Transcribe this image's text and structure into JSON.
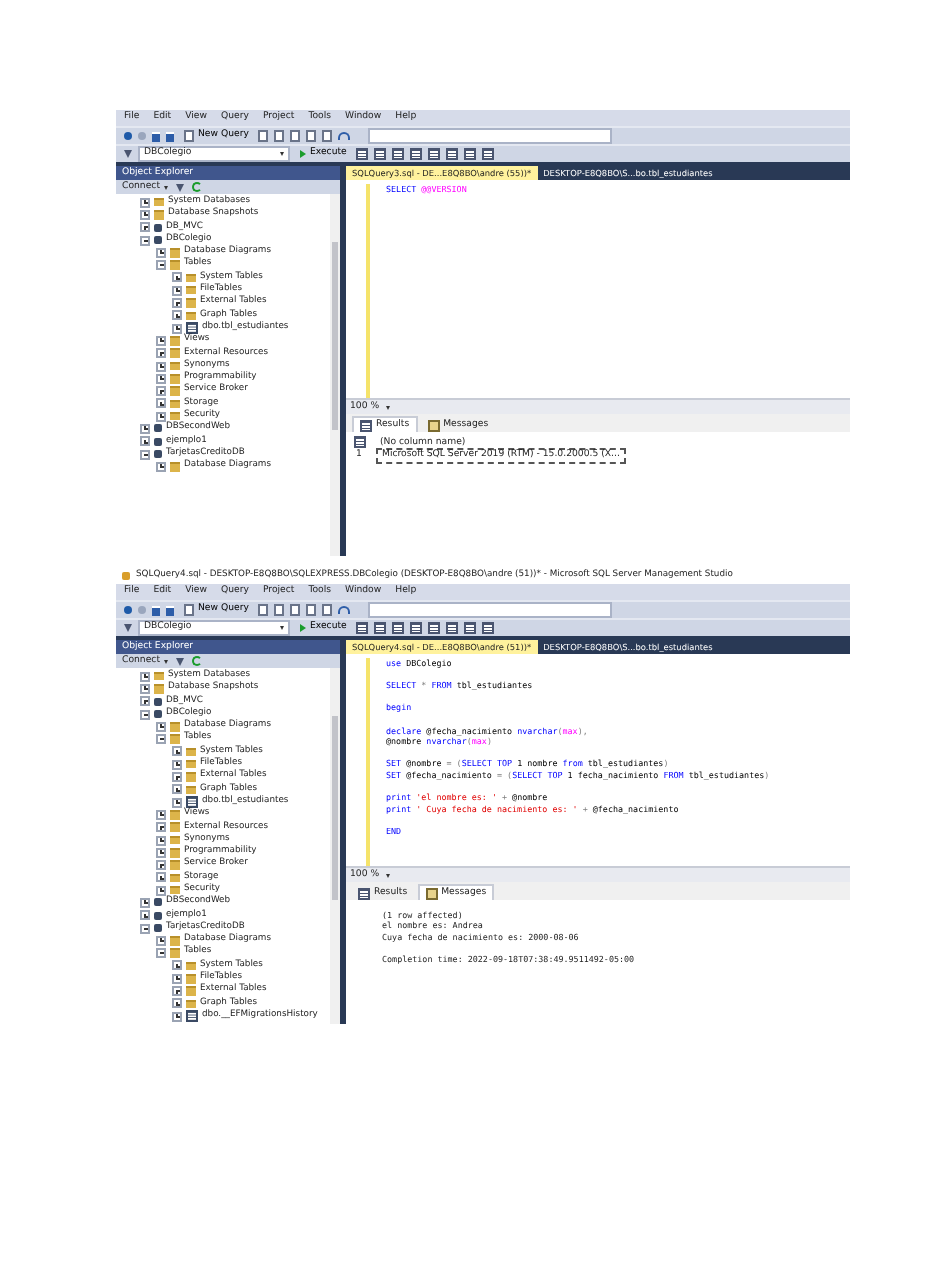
{
  "shots": [
    {
      "menu": [
        "File",
        "Edit",
        "View",
        "Query",
        "Project",
        "Tools",
        "Window",
        "Help"
      ],
      "toolbar": {
        "new_query": "New Query",
        "database": "DBColegio",
        "execute": "Execute"
      },
      "explorer": {
        "title": "Object Explorer",
        "connect": "Connect",
        "tree": [
          {
            "label": "System Databases",
            "kind": "folder",
            "expanded": false
          },
          {
            "label": "Database Snapshots",
            "kind": "folder",
            "expanded": false
          },
          {
            "label": "DB_MVC",
            "kind": "db",
            "expanded": false
          },
          {
            "label": "DBColegio",
            "kind": "db",
            "expanded": true,
            "children": [
              {
                "label": "Database Diagrams",
                "kind": "folder",
                "expanded": false
              },
              {
                "label": "Tables",
                "kind": "folder",
                "expanded": true,
                "children": [
                  {
                    "label": "System Tables",
                    "kind": "folder",
                    "expanded": false
                  },
                  {
                    "label": "FileTables",
                    "kind": "folder",
                    "expanded": false
                  },
                  {
                    "label": "External Tables",
                    "kind": "folder",
                    "expanded": false
                  },
                  {
                    "label": "Graph Tables",
                    "kind": "folder",
                    "expanded": false
                  },
                  {
                    "label": "dbo.tbl_estudiantes",
                    "kind": "table",
                    "expanded": false
                  }
                ]
              },
              {
                "label": "Views",
                "kind": "folder",
                "expanded": false
              },
              {
                "label": "External Resources",
                "kind": "folder",
                "expanded": false
              },
              {
                "label": "Synonyms",
                "kind": "folder",
                "expanded": false
              },
              {
                "label": "Programmability",
                "kind": "folder",
                "expanded": false
              },
              {
                "label": "Service Broker",
                "kind": "folder",
                "expanded": false
              },
              {
                "label": "Storage",
                "kind": "folder",
                "expanded": false
              },
              {
                "label": "Security",
                "kind": "folder",
                "expanded": false
              }
            ]
          },
          {
            "label": "DBSecondWeb",
            "kind": "db",
            "expanded": false
          },
          {
            "label": "ejemplo1",
            "kind": "db",
            "expanded": false
          },
          {
            "label": "TarjetasCreditoDB",
            "kind": "db",
            "expanded": true,
            "children": [
              {
                "label": "Database Diagrams",
                "kind": "folder",
                "expanded": false
              }
            ]
          }
        ]
      },
      "tabs": [
        {
          "label": "SQLQuery3.sql - DE...E8Q8BO\\andre (55))*",
          "selected": true
        },
        {
          "label": "DESKTOP-E8Q8BO\\S...bo.tbl_estudiantes",
          "selected": false
        }
      ],
      "code": [
        {
          "segments": [
            {
              "text": "SELECT ",
              "kind": "keyword"
            },
            {
              "text": "@@VERSION",
              "kind": "function"
            }
          ]
        }
      ],
      "zoom": "100 %",
      "result_tabs": [
        {
          "label": "Results",
          "selected": true
        },
        {
          "label": "Messages",
          "selected": false
        }
      ],
      "results": {
        "kind": "grid",
        "columns": [
          "",
          "(No column name)"
        ],
        "rows": [
          [
            "1",
            "Microsoft SQL Server 2019 (RTM) - 15.0.2000.5 (X..."
          ]
        ]
      }
    },
    {
      "title": "SQLQuery4.sql - DESKTOP-E8Q8BO\\SQLEXPRESS.DBColegio (DESKTOP-E8Q8BO\\andre (51))* - Microsoft SQL Server Management Studio",
      "menu": [
        "File",
        "Edit",
        "View",
        "Query",
        "Project",
        "Tools",
        "Window",
        "Help"
      ],
      "toolbar": {
        "new_query": "New Query",
        "database": "DBColegio",
        "execute": "Execute"
      },
      "explorer": {
        "title": "Object Explorer",
        "connect": "Connect",
        "tree": [
          {
            "label": "System Databases",
            "kind": "folder",
            "expanded": false
          },
          {
            "label": "Database Snapshots",
            "kind": "folder",
            "expanded": false
          },
          {
            "label": "DB_MVC",
            "kind": "db",
            "expanded": false
          },
          {
            "label": "DBColegio",
            "kind": "db",
            "expanded": true,
            "children": [
              {
                "label": "Database Diagrams",
                "kind": "folder",
                "expanded": false
              },
              {
                "label": "Tables",
                "kind": "folder",
                "expanded": true,
                "children": [
                  {
                    "label": "System Tables",
                    "kind": "folder",
                    "expanded": false
                  },
                  {
                    "label": "FileTables",
                    "kind": "folder",
                    "expanded": false
                  },
                  {
                    "label": "External Tables",
                    "kind": "folder",
                    "expanded": false
                  },
                  {
                    "label": "Graph Tables",
                    "kind": "folder",
                    "expanded": false
                  },
                  {
                    "label": "dbo.tbl_estudiantes",
                    "kind": "table",
                    "expanded": false
                  }
                ]
              },
              {
                "label": "Views",
                "kind": "folder",
                "expanded": false
              },
              {
                "label": "External Resources",
                "kind": "folder",
                "expanded": false
              },
              {
                "label": "Synonyms",
                "kind": "folder",
                "expanded": false
              },
              {
                "label": "Programmability",
                "kind": "folder",
                "expanded": false
              },
              {
                "label": "Service Broker",
                "kind": "folder",
                "expanded": false
              },
              {
                "label": "Storage",
                "kind": "folder",
                "expanded": false
              },
              {
                "label": "Security",
                "kind": "folder",
                "expanded": false
              }
            ]
          },
          {
            "label": "DBSecondWeb",
            "kind": "db",
            "expanded": false
          },
          {
            "label": "ejemplo1",
            "kind": "db",
            "expanded": false
          },
          {
            "label": "TarjetasCreditoDB",
            "kind": "db",
            "expanded": true,
            "children": [
              {
                "label": "Database Diagrams",
                "kind": "folder",
                "expanded": false
              },
              {
                "label": "Tables",
                "kind": "folder",
                "expanded": true,
                "children": [
                  {
                    "label": "System Tables",
                    "kind": "folder",
                    "expanded": false
                  },
                  {
                    "label": "FileTables",
                    "kind": "folder",
                    "expanded": false
                  },
                  {
                    "label": "External Tables",
                    "kind": "folder",
                    "expanded": false
                  },
                  {
                    "label": "Graph Tables",
                    "kind": "folder",
                    "expanded": false
                  },
                  {
                    "label": "dbo.__EFMigrationsHistory",
                    "kind": "table",
                    "expanded": false
                  }
                ]
              }
            ]
          }
        ]
      },
      "tabs": [
        {
          "label": "SQLQuery4.sql - DE...E8Q8BO\\andre (51))*",
          "selected": true
        },
        {
          "label": "DESKTOP-E8Q8BO\\S...bo.tbl_estudiantes",
          "selected": false
        }
      ],
      "code": [
        {
          "segments": [
            {
              "text": "use ",
              "kind": "keyword"
            },
            {
              "text": "DBColegio",
              "kind": "plain"
            }
          ]
        },
        {
          "gap_before": true,
          "segments": [
            {
              "text": "SELECT ",
              "kind": "keyword"
            },
            {
              "text": "* ",
              "kind": "operator"
            },
            {
              "text": "FROM ",
              "kind": "keyword"
            },
            {
              "text": "tbl_estudiantes",
              "kind": "plain"
            }
          ]
        },
        {
          "gap_before": true,
          "segments": [
            {
              "text": "begin",
              "kind": "keyword"
            }
          ]
        },
        {
          "gap_before": true,
          "segments": [
            {
              "text": "declare ",
              "kind": "keyword"
            },
            {
              "text": "@fecha_nacimiento ",
              "kind": "plain"
            },
            {
              "text": "nvarchar",
              "kind": "keyword"
            },
            {
              "text": "(",
              "kind": "operator"
            },
            {
              "text": "max",
              "kind": "function"
            },
            {
              "text": "),",
              "kind": "operator"
            }
          ]
        },
        {
          "segments": [
            {
              "text": "@nombre ",
              "kind": "plain"
            },
            {
              "text": "nvarchar",
              "kind": "keyword"
            },
            {
              "text": "(",
              "kind": "operator"
            },
            {
              "text": "max",
              "kind": "function"
            },
            {
              "text": ")",
              "kind": "operator"
            }
          ]
        },
        {
          "gap_before": true,
          "segments": [
            {
              "text": "SET ",
              "kind": "keyword"
            },
            {
              "text": "@nombre ",
              "kind": "plain"
            },
            {
              "text": "= (",
              "kind": "operator"
            },
            {
              "text": "SELECT TOP ",
              "kind": "keyword"
            },
            {
              "text": "1 nombre ",
              "kind": "plain"
            },
            {
              "text": "from ",
              "kind": "keyword"
            },
            {
              "text": "tbl_estudiantes",
              "kind": "plain"
            },
            {
              "text": ")",
              "kind": "operator"
            }
          ]
        },
        {
          "segments": [
            {
              "text": "SET ",
              "kind": "keyword"
            },
            {
              "text": "@fecha_nacimiento ",
              "kind": "plain"
            },
            {
              "text": "= (",
              "kind": "operator"
            },
            {
              "text": "SELECT TOP ",
              "kind": "keyword"
            },
            {
              "text": "1 fecha_nacimiento ",
              "kind": "plain"
            },
            {
              "text": "FROM ",
              "kind": "keyword"
            },
            {
              "text": "tbl_estudiantes",
              "kind": "plain"
            },
            {
              "text": ")",
              "kind": "operator"
            }
          ]
        },
        {
          "gap_before": true,
          "segments": [
            {
              "text": "print ",
              "kind": "keyword"
            },
            {
              "text": "'el nombre es: ' ",
              "kind": "string"
            },
            {
              "text": "+ ",
              "kind": "operator"
            },
            {
              "text": "@nombre",
              "kind": "plain"
            }
          ]
        },
        {
          "segments": [
            {
              "text": "print ",
              "kind": "keyword"
            },
            {
              "text": "' Cuya fecha de nacimiento es: ' ",
              "kind": "string"
            },
            {
              "text": "+ ",
              "kind": "operator"
            },
            {
              "text": "@fecha_nacimiento",
              "kind": "plain"
            }
          ]
        },
        {
          "gap_before": true,
          "segments": [
            {
              "text": "END",
              "kind": "keyword"
            }
          ]
        }
      ],
      "zoom": "100 %",
      "result_tabs": [
        {
          "label": "Results",
          "selected": false
        },
        {
          "label": "Messages",
          "selected": true
        }
      ],
      "results": {
        "kind": "messages",
        "lines": [
          {
            "text": "(1 row affected)"
          },
          {
            "text": "el nombre es: Andrea"
          },
          {
            "text": "Cuya fecha de nacimiento es: 2000-08-06"
          },
          {
            "text": "Completion time: 2022-09-18T07:38:49.9511492-05:00",
            "gap_before": true
          }
        ]
      }
    }
  ]
}
